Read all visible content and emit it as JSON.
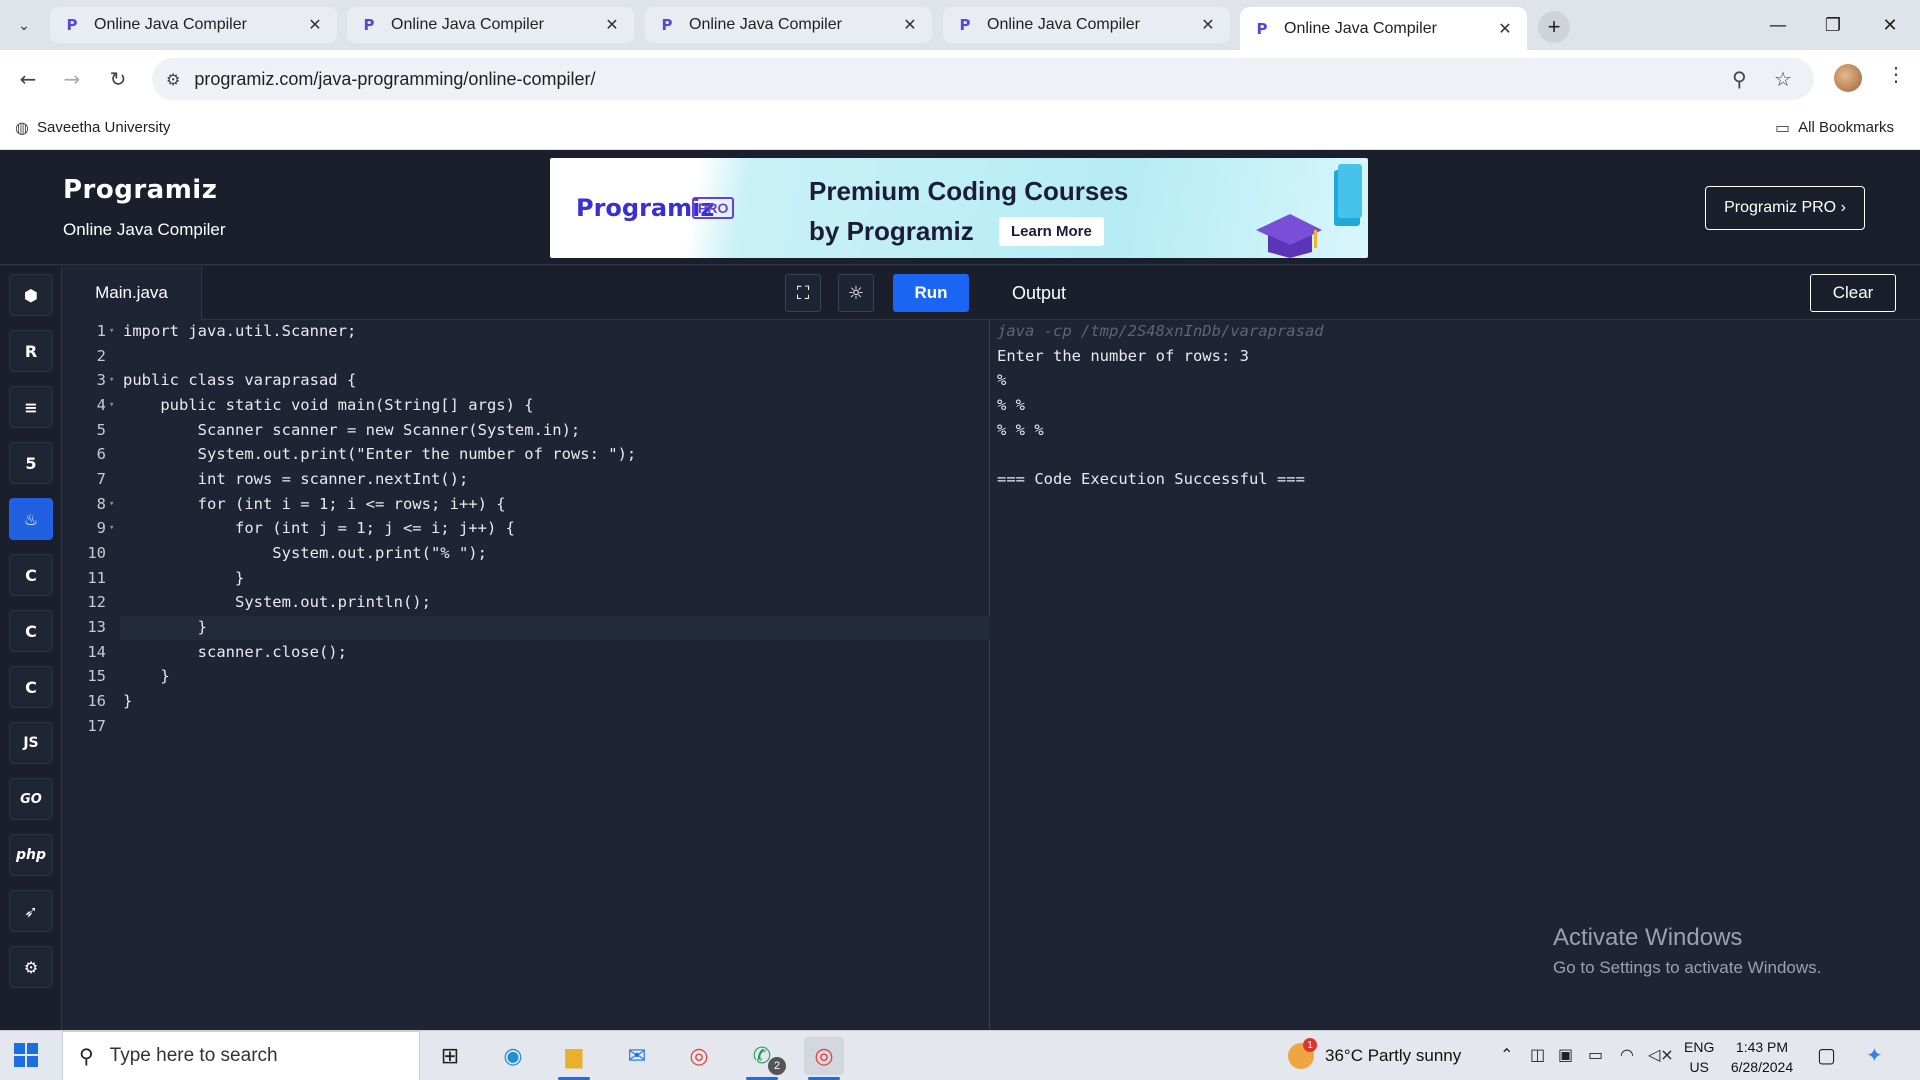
{
  "browser": {
    "tabs": [
      {
        "title": "Online Java Compiler"
      },
      {
        "title": "Online Java Compiler"
      },
      {
        "title": "Online Java Compiler"
      },
      {
        "title": "Online Java Compiler"
      },
      {
        "title": "Online Java Compiler"
      }
    ],
    "url": "programiz.com/java-programming/online-compiler/",
    "bookmarks": {
      "left": "Saveetha University",
      "right": "All Bookmarks"
    }
  },
  "header": {
    "logo": "Programiz",
    "subtitle": "Online Java Compiler",
    "pro_button": "Programiz PRO ›"
  },
  "banner": {
    "logo": "Programiz",
    "badge": "PRO",
    "line1": "Premium Coding Courses",
    "line2": "by Programiz",
    "cta": "Learn More"
  },
  "sidebar": {
    "languages": [
      {
        "name": "python",
        "glyph": "⬢"
      },
      {
        "name": "r",
        "glyph": "R"
      },
      {
        "name": "sql",
        "glyph": "≡"
      },
      {
        "name": "html",
        "glyph": "5"
      },
      {
        "name": "java",
        "glyph": "♨"
      },
      {
        "name": "c",
        "glyph": "C"
      },
      {
        "name": "cpp",
        "glyph": "C"
      },
      {
        "name": "csharp",
        "glyph": "C"
      },
      {
        "name": "javascript",
        "glyph": "JS"
      },
      {
        "name": "go",
        "glyph": "GO"
      },
      {
        "name": "php",
        "glyph": "php"
      },
      {
        "name": "swift",
        "glyph": "➶"
      },
      {
        "name": "rust",
        "glyph": "⚙"
      }
    ],
    "active": "java"
  },
  "editor": {
    "file_tab": "Main.java",
    "run_label": "Run",
    "code": [
      "import java.util.Scanner;",
      "",
      "public class varaprasad {",
      "    public static void main(String[] args) {",
      "        Scanner scanner = new Scanner(System.in);",
      "        System.out.print(\"Enter the number of rows: \");",
      "        int rows = scanner.nextInt();",
      "        for (int i = 1; i <= rows; i++) {",
      "            for (int j = 1; j <= i; j++) {",
      "                System.out.print(\"% \");",
      "            }",
      "            System.out.println();",
      "        }",
      "        scanner.close();",
      "    }",
      "}",
      ""
    ]
  },
  "output": {
    "title": "Output",
    "clear_label": "Clear",
    "command": "java -cp /tmp/2S48xnInDb/varaprasad",
    "lines": [
      "Enter the number of rows: 3",
      "%",
      "% %",
      "% % %",
      "",
      "=== Code Execution Successful ==="
    ],
    "watermark_line1": "Activate Windows",
    "watermark_line2": "Go to Settings to activate Windows."
  },
  "taskbar": {
    "search_placeholder": "Type here to search",
    "weather": "36°C  Partly sunny",
    "lang_top": "ENG",
    "lang_bottom": "US",
    "time": "1:43 PM",
    "date": "6/28/2024",
    "whatsapp_badge": "2",
    "weather_badge": "1"
  }
}
